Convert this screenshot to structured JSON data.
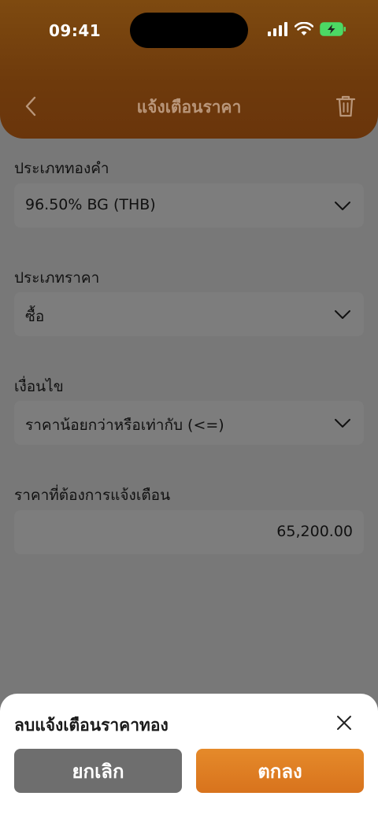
{
  "status_bar": {
    "time": "09:41",
    "icons": [
      "cellular-signal-icon",
      "wifi-icon",
      "battery-charging-icon"
    ]
  },
  "nav": {
    "title": "แจ้งเตือนราคา",
    "back_icon": "chevron-left-icon",
    "trash_icon": "trash-icon"
  },
  "form": {
    "gold_type": {
      "label": "ประเภททองคำ",
      "value": "96.50% BG (THB)"
    },
    "price_type": {
      "label": "ประเภทราคา",
      "value": "ซื้อ"
    },
    "condition": {
      "label": "เงื่อนไข",
      "value": "ราคาน้อยกว่าหรือเท่ากับ (<=)"
    },
    "target_price": {
      "label": "ราคาที่ต้องการแจ้งเตือน",
      "value": "65,200.00"
    }
  },
  "sheet": {
    "title": "ลบแจ้งเตือนราคาทอง",
    "cancel_label": "ยกเลิก",
    "confirm_label": "ตกลง"
  },
  "colors": {
    "header": "#6e3a0c",
    "accent": "#e0801f",
    "overlay": "#787878",
    "battery": "#4cd964"
  }
}
